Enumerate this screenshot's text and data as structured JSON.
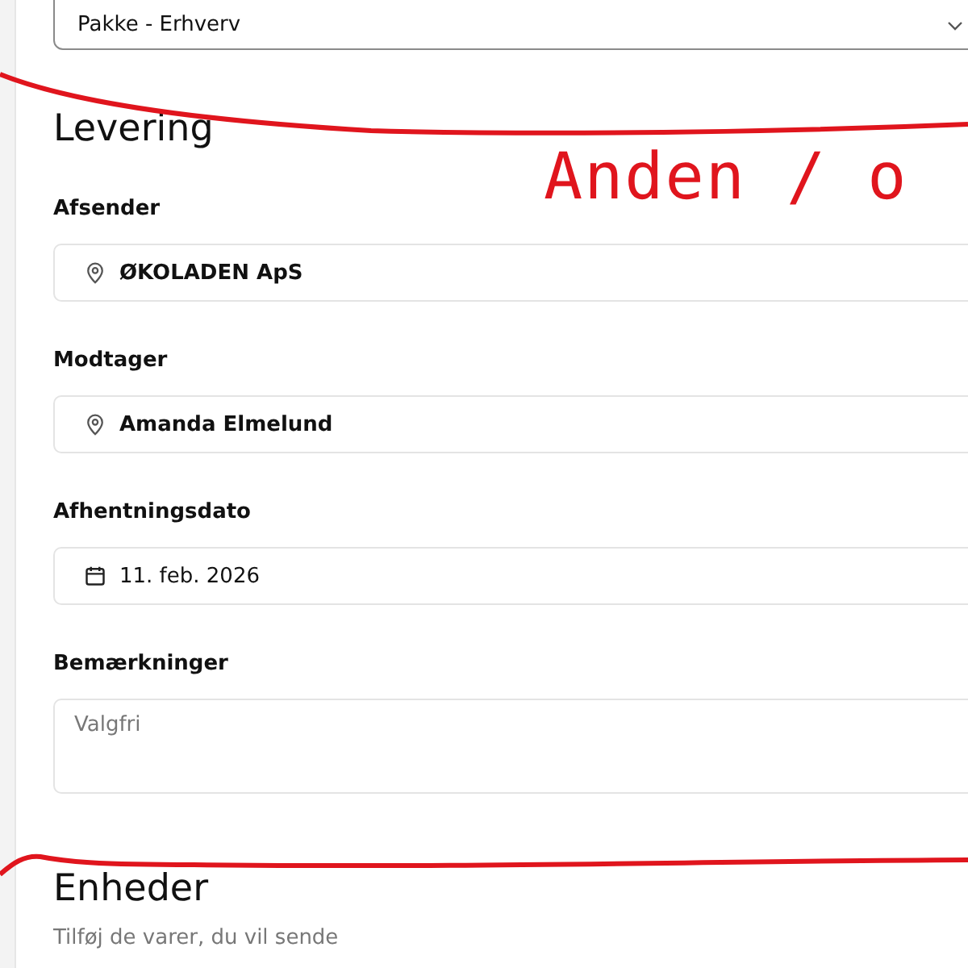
{
  "type_select": {
    "value": "Pakke - Erhverv"
  },
  "section": {
    "title": "Levering"
  },
  "fields": [
    {
      "kind": "location",
      "label": "Afsender",
      "value": "ØKOLADEN ApS"
    },
    {
      "kind": "location",
      "label": "Modtager",
      "value": "Amanda Elmelund"
    },
    {
      "kind": "date",
      "label": "Afhentningsdato",
      "value": "11. feb. 2026"
    },
    {
      "kind": "textarea",
      "label": "Bemærkninger",
      "placeholder": "Valgfri"
    }
  ],
  "next_section": {
    "title": "Enheder",
    "subtitle": "Tilføj de varer, du vil sende"
  },
  "annotation": {
    "text": "Anden / o"
  }
}
